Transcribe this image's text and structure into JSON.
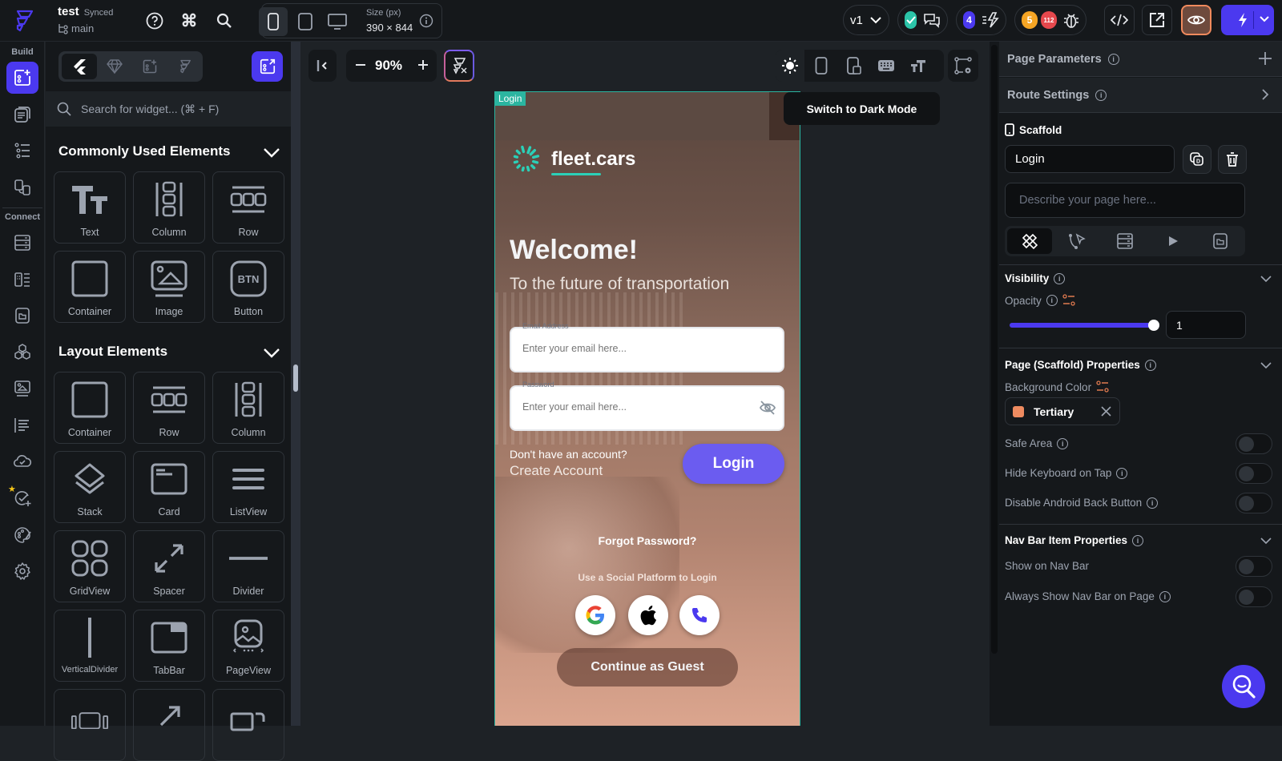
{
  "topbar": {
    "project_name": "test",
    "sync_status": "Synced",
    "branch": "main",
    "size_label": "Size (px)",
    "size_value": "390 × 844",
    "version": "v1",
    "agent_count": "4",
    "warning_count": "5",
    "error_count": "112",
    "colors": {
      "accent": "#4b39ef",
      "success": "#2bc4a8",
      "warning": "#f5a524",
      "error": "#e5484d",
      "preview_border": "#f08a5d"
    }
  },
  "rail": {
    "build_label": "Build",
    "connect_label": "Connect"
  },
  "widget_panel": {
    "search_placeholder": "Search for widget... (⌘ + F)",
    "common_title": "Commonly Used Elements",
    "common_items": [
      "Text",
      "Column",
      "Row",
      "Container",
      "Image",
      "Button"
    ],
    "layout_title": "Layout Elements",
    "layout_items": [
      "Container",
      "Row",
      "Column",
      "Stack",
      "Card",
      "ListView",
      "GridView",
      "Spacer",
      "Divider",
      "VerticalDivider",
      "TabBar",
      "PageView"
    ]
  },
  "canvas": {
    "zoom": "90%",
    "tooltip": "Switch to Dark Mode",
    "page_label": "Login"
  },
  "app": {
    "brand": "fleet.cars",
    "welcome": "Welcome!",
    "tagline": "To the future of transportation",
    "email_label": "Email Address",
    "email_placeholder": "Enter your email here...",
    "password_label": "Password",
    "password_placeholder": "Enter your email here...",
    "no_account": "Don't have an account?",
    "create_account": "Create Account",
    "login": "Login",
    "forgot": "Forgot Password?",
    "social_label": "Use a Social Platform to Login",
    "guest": "Continue as Guest"
  },
  "properties": {
    "page_parameters": "Page Parameters",
    "route_settings": "Route Settings",
    "scaffold": "Scaffold",
    "page_name": "Login",
    "describe_placeholder": "Describe your page here...",
    "visibility": "Visibility",
    "opacity_label": "Opacity",
    "opacity_value": "1",
    "opacity_fraction": 1,
    "page_props_title": "Page (Scaffold) Properties",
    "bg_color_label": "Background Color",
    "bg_color_value": "Tertiary",
    "bg_color_hex": "#ee8b60",
    "safe_area": "Safe Area",
    "safe_area_on": false,
    "hide_keyboard": "Hide Keyboard on Tap",
    "hide_keyboard_on": false,
    "disable_back": "Disable Android Back Button",
    "disable_back_on": false,
    "nav_title": "Nav Bar Item Properties",
    "show_nav": "Show on Nav Bar",
    "show_nav_on": false,
    "always_nav": "Always Show Nav Bar on Page",
    "always_nav_on": false
  }
}
